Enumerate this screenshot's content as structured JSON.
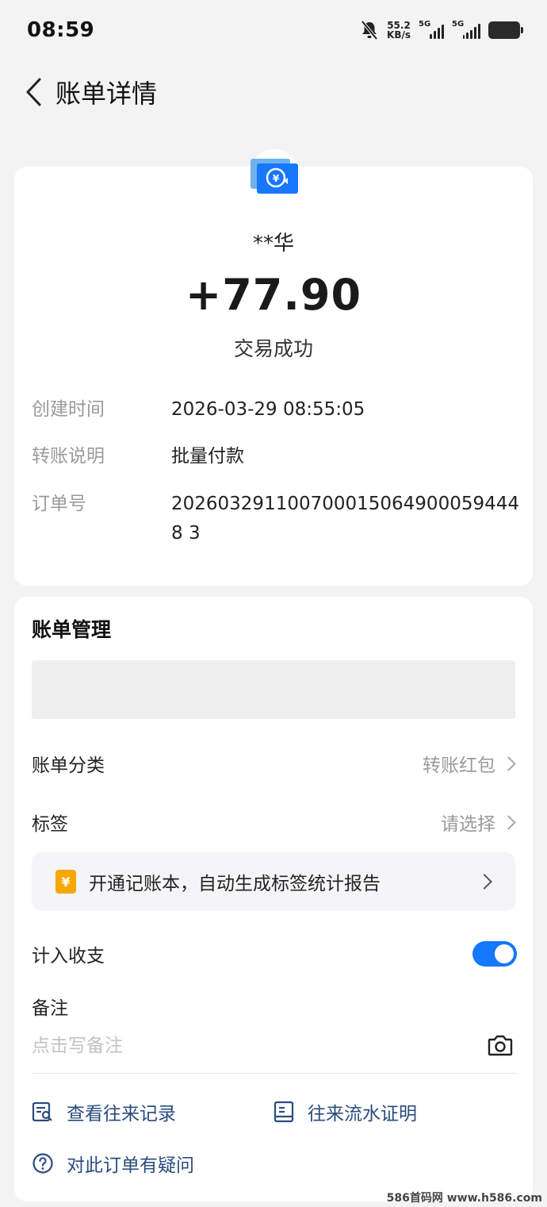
{
  "status_bar": {
    "time": "08:59",
    "net_speed_value": "55.2",
    "net_speed_unit": "KB/s",
    "sim1": "5G",
    "sim2": "5G"
  },
  "nav": {
    "title": "账单详情"
  },
  "summary": {
    "payer": "**华",
    "amount": "+77.90",
    "status": "交易成功",
    "accent_color": "#1677ff"
  },
  "details": [
    {
      "label": "创建时间",
      "value": "2026-03-29 08:55:05"
    },
    {
      "label": "转账说明",
      "value": "批量付款"
    },
    {
      "label": "订单号",
      "value": "2026032911007000150649000594448 3"
    }
  ],
  "manage": {
    "title": "账单管理",
    "category_label": "账单分类",
    "category_value": "转账红包",
    "tag_label": "标签",
    "tag_value": "请选择",
    "promo_icon": "¥",
    "promo_text": "开通记账本，自动生成标签统计报告",
    "include_label": "计入收支",
    "include_enabled": true,
    "note_label": "备注",
    "note_placeholder": "点击写备注"
  },
  "links": {
    "history": "查看往来记录",
    "proof": "往来流水证明",
    "question": "对此订单有疑问"
  },
  "watermark": "586首码网 www.h586.com"
}
